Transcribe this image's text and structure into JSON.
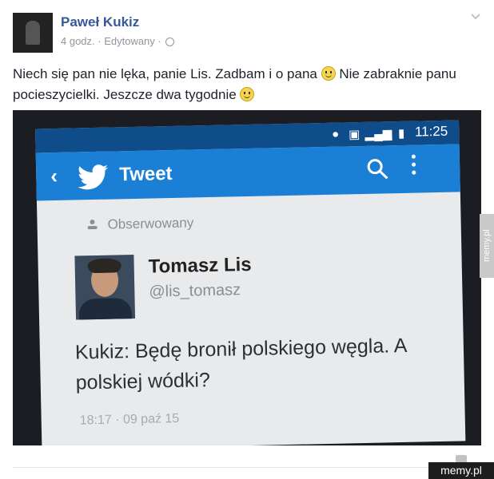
{
  "post": {
    "author": "Paweł Kukiz",
    "meta": "4 godz. · Edytowany ·",
    "text_line1": "Niech się pan nie lęka, panie Lis. Zadbam i o pana",
    "text_line1b": "Nie zabraknie panu",
    "text_line2": "pocieszycielki. Jeszcze dwa tygodnie"
  },
  "phone": {
    "status": {
      "time": "11:25"
    },
    "header": {
      "title": "Tweet"
    },
    "followed_label": "Obserwowany",
    "tweet": {
      "name": "Tomasz Lis",
      "handle": "@lis_tomasz",
      "text": "Kukiz: Będę bronił polskiego węgla. A polskiej wódki?",
      "time": "18:17 · 09 paź 15"
    }
  },
  "watermark": {
    "side": "memy.pl",
    "corner": "memy.pl"
  },
  "colors": {
    "author": "#365899",
    "twitter_bar": "#1c7fd6",
    "status_bar": "#0f4c8a"
  }
}
